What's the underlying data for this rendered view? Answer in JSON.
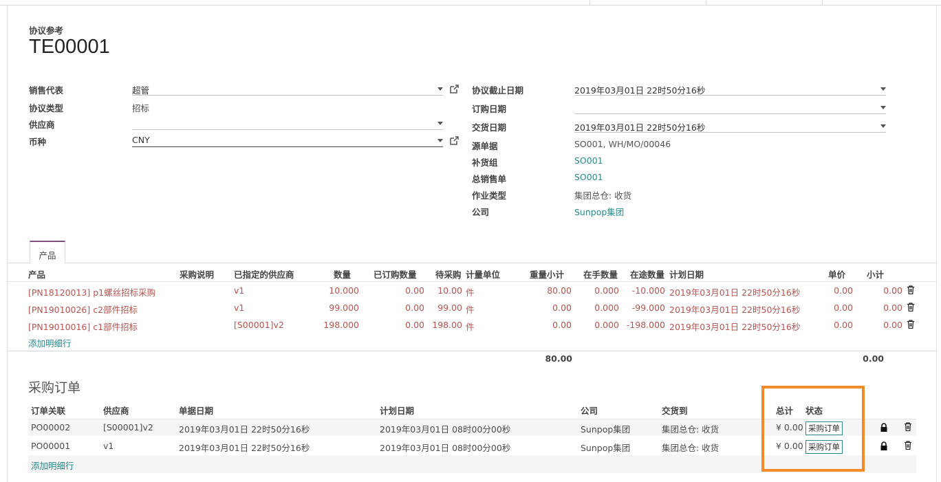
{
  "header": {
    "ref_label": "协议参考",
    "ref_value": "TE00001"
  },
  "left_fields": {
    "sales_rep": {
      "label": "销售代表",
      "value": "超管"
    },
    "agreement_type": {
      "label": "协议类型",
      "value": "招标"
    },
    "vendor": {
      "label": "供应商",
      "value": ""
    },
    "currency": {
      "label": "币种",
      "value": "CNY"
    }
  },
  "right_fields": {
    "deadline": {
      "label": "协议截止日期",
      "value": "2019年03月01日 22时50分16秒"
    },
    "order_date": {
      "label": "订购日期",
      "value": ""
    },
    "delivery_date": {
      "label": "交货日期",
      "value": "2019年03月01日 22时50分16秒"
    },
    "source": {
      "label": "源单据",
      "value": "SO001, WH/MO/00046"
    },
    "procurement_group": {
      "label": "补货组",
      "value": "SO001"
    },
    "sale_order": {
      "label": "总销售单",
      "value": "SO001"
    },
    "operation_type": {
      "label": "作业类型",
      "value": "集团总仓: 收货"
    },
    "company": {
      "label": "公司",
      "value": "Sunpop集团"
    }
  },
  "tab": {
    "label": "产品"
  },
  "product_table": {
    "headers": {
      "product": "产品",
      "desc": "采购说明",
      "vendor": "已指定的供应商",
      "qty": "数量",
      "ordered": "已订购数量",
      "pending": "待采购",
      "uom": "计量单位",
      "weight": "重量小计",
      "onhand": "在手数量",
      "incoming": "在途数量",
      "planned": "计划日期",
      "price": "单价",
      "subtotal": "小计"
    },
    "rows": [
      {
        "product": "[PN18120013] p1螺丝招标采购",
        "vendor": "v1",
        "qty": "10.000",
        "ordered": "0.00",
        "pending": "10.00",
        "uom": "件",
        "weight": "80.00",
        "onhand": "0.000",
        "incoming": "-10.000",
        "planned": "2019年03月01日 22时50分16秒",
        "price": "0.00",
        "subtotal": "0.00"
      },
      {
        "product": "[PN19010026] c2部件招标",
        "vendor": "v1",
        "qty": "99.000",
        "ordered": "0.00",
        "pending": "99.00",
        "uom": "件",
        "weight": "0.00",
        "onhand": "0.000",
        "incoming": "-99.000",
        "planned": "2019年03月01日 22时50分16秒",
        "price": "0.00",
        "subtotal": "0.00"
      },
      {
        "product": "[PN19010016] c1部件招标",
        "vendor": "[S00001]v2",
        "qty": "198.000",
        "ordered": "0.00",
        "pending": "198.00",
        "uom": "件",
        "weight": "0.00",
        "onhand": "0.000",
        "incoming": "-198.000",
        "planned": "2019年03月01日 22时50分16秒",
        "price": "0.00",
        "subtotal": "0.00"
      }
    ],
    "add_line": "添加明细行",
    "totals": {
      "weight": "80.00",
      "subtotal": "0.00"
    }
  },
  "purchase_orders": {
    "title": "采购订单",
    "headers": {
      "ref": "订单关联",
      "vendor": "供应商",
      "date": "单据日期",
      "planned": "计划日期",
      "company": "公司",
      "deliver_to": "交货到",
      "total": "总计",
      "status": "状态"
    },
    "rows": [
      {
        "ref": "PO00002",
        "vendor": "[S00001]v2",
        "date": "2019年03月01日 22时50分16秒",
        "planned": "2019年03月01日 08时00分00秒",
        "company": "Sunpop集团",
        "deliver_to": "集团总仓: 收货",
        "total": "¥ 0.00",
        "status": "采购订单"
      },
      {
        "ref": "PO00001",
        "vendor": "v1",
        "date": "2019年03月01日 22时50分16秒",
        "planned": "2019年03月01日 08时00分00秒",
        "company": "Sunpop集团",
        "deliver_to": "集团总仓: 收货",
        "total": "¥ 0.00",
        "status": "采购订单"
      }
    ],
    "add_line": "添加明细行"
  },
  "colors": {
    "accent": "#2a8a8a",
    "red_text": "#b85450",
    "highlight": "#f28c28",
    "tab_top": "#7c4e7e"
  }
}
